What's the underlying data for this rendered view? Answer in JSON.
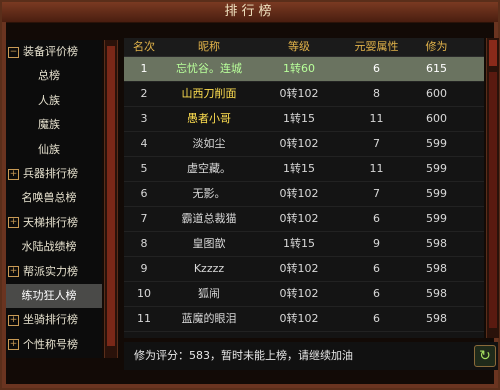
{
  "title": "排行榜",
  "sidebar": {
    "items": [
      {
        "label": "装备评价榜",
        "expand": "−",
        "type": "group"
      },
      {
        "label": "总榜",
        "type": "sub"
      },
      {
        "label": "人族",
        "type": "sub"
      },
      {
        "label": "魔族",
        "type": "sub"
      },
      {
        "label": "仙族",
        "type": "sub"
      },
      {
        "label": "兵器排行榜",
        "expand": "+",
        "type": "group"
      },
      {
        "label": "名唤兽总榜",
        "type": "sub"
      },
      {
        "label": "天梯排行榜",
        "expand": "+",
        "type": "group"
      },
      {
        "label": "水陆战绩榜",
        "type": "sub"
      },
      {
        "label": "帮派实力榜",
        "expand": "+",
        "type": "group"
      },
      {
        "label": "练功狂人榜",
        "type": "sub",
        "selected": true
      },
      {
        "label": "坐骑排行榜",
        "expand": "+",
        "type": "group"
      },
      {
        "label": "个性称号榜",
        "expand": "+",
        "type": "group"
      }
    ]
  },
  "table": {
    "headers": [
      "名次",
      "昵称",
      "等级",
      "元婴属性",
      "修为"
    ],
    "rows": [
      {
        "rank": "1",
        "name": "忘忧谷。连城",
        "level": "1转60",
        "attr": "6",
        "xiuwei": "615",
        "selected": true
      },
      {
        "rank": "2",
        "name": "山西刀削面",
        "level": "0转102",
        "attr": "8",
        "xiuwei": "600",
        "yellow": true
      },
      {
        "rank": "3",
        "name": "愚者小哥",
        "level": "1转15",
        "attr": "11",
        "xiuwei": "600",
        "yellow": true
      },
      {
        "rank": "4",
        "name": "淡如尘",
        "level": "0转102",
        "attr": "7",
        "xiuwei": "599"
      },
      {
        "rank": "5",
        "name": "虚空藏。",
        "level": "1转15",
        "attr": "11",
        "xiuwei": "599"
      },
      {
        "rank": "6",
        "name": "无影。",
        "level": "0转102",
        "attr": "7",
        "xiuwei": "599"
      },
      {
        "rank": "7",
        "name": "霸道总裁猫",
        "level": "0转102",
        "attr": "6",
        "xiuwei": "599"
      },
      {
        "rank": "8",
        "name": "皇图歆",
        "level": "1转15",
        "attr": "9",
        "xiuwei": "598"
      },
      {
        "rank": "9",
        "name": "Kzzzz",
        "level": "0转102",
        "attr": "6",
        "xiuwei": "598"
      },
      {
        "rank": "10",
        "name": "狐闹",
        "level": "0转102",
        "attr": "6",
        "xiuwei": "598"
      },
      {
        "rank": "11",
        "name": "蓝魔的眼泪",
        "level": "0转102",
        "attr": "6",
        "xiuwei": "598"
      }
    ]
  },
  "footer": {
    "text": "修为评分：583，暂时未能上榜，请继续加油"
  },
  "icons": {
    "refresh": "refresh-icon"
  }
}
